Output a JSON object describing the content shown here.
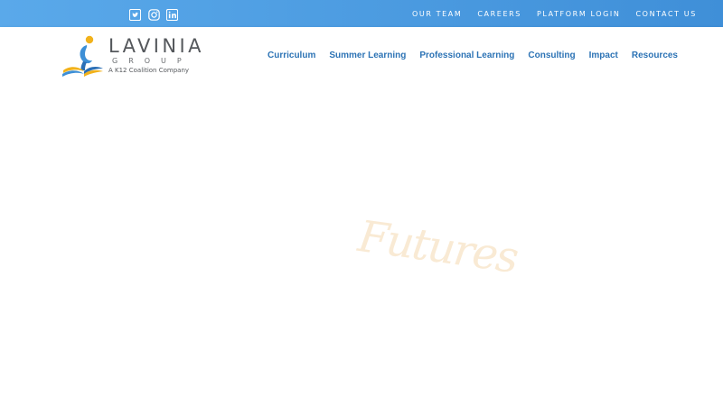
{
  "social": {
    "twitter": "twitter-icon",
    "instagram": "instagram-icon",
    "linkedin": "linkedin-icon"
  },
  "topnav": {
    "items": [
      {
        "label": "OUR TEAM"
      },
      {
        "label": "CAREERS"
      },
      {
        "label": "PLATFORM LOGIN"
      },
      {
        "label": "CONTACT US"
      }
    ]
  },
  "logo": {
    "title": "LAVINIA",
    "subtitle": "GROUP",
    "tagline": "A K12 Coalition Company"
  },
  "mainnav": {
    "items": [
      {
        "label": "Curriculum"
      },
      {
        "label": "Summer Learning"
      },
      {
        "label": "Professional Learning"
      },
      {
        "label": "Consulting"
      },
      {
        "label": "Impact"
      },
      {
        "label": "Resources"
      }
    ]
  },
  "hero": {
    "script_text": "Futures"
  },
  "colors": {
    "topbar": "#4a9be2",
    "nav_link": "#2c73b5",
    "script": "#f7e3c6"
  }
}
